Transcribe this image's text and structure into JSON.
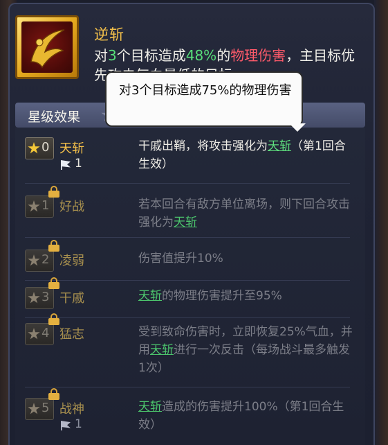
{
  "skill": {
    "name": "逆斩",
    "desc_p1": "对",
    "desc_targets": "3",
    "desc_p2": "个目标造成",
    "desc_percent": "48%",
    "desc_p3": "的",
    "desc_damage": "物理伤害",
    "desc_p4": "，主目标优先攻击气血最低的目标",
    "icon": "crimson-slash-skill-icon"
  },
  "tooltip": {
    "text": "对3个目标造成75%的物理伤害"
  },
  "star_section": {
    "title": "星级效果"
  },
  "effects": [
    {
      "stars": "0",
      "name": "天斩",
      "active": true,
      "locked": false,
      "flag_count": "1",
      "desc_parts": [
        {
          "text": "干戚出鞘，将攻击强化为"
        },
        {
          "text": "天斩",
          "link": true
        },
        {
          "text": "（第1回合生效）"
        }
      ]
    },
    {
      "stars": "1",
      "name": "好战",
      "active": false,
      "locked": true,
      "desc_parts": [
        {
          "text": "若本回合有敌方单位离场，则下回合攻击强化为"
        },
        {
          "text": "天斩",
          "link": true
        }
      ]
    },
    {
      "stars": "2",
      "name": "凌弱",
      "active": false,
      "locked": true,
      "desc_parts": [
        {
          "text": "伤害值提升10%"
        }
      ]
    },
    {
      "stars": "3",
      "name": "干戚",
      "active": false,
      "locked": true,
      "desc_parts": [
        {
          "text": "天斩",
          "link": true
        },
        {
          "text": "的物理伤害提升至95%"
        }
      ]
    },
    {
      "stars": "4",
      "name": "猛志",
      "active": false,
      "locked": true,
      "desc_parts": [
        {
          "text": "受到致命伤害时，立即恢复25%气血，并用"
        },
        {
          "text": "天斩",
          "link": true
        },
        {
          "text": "进行一次反击（每场战斗最多触发1次）"
        }
      ]
    },
    {
      "stars": "5",
      "name": "战神",
      "active": false,
      "locked": true,
      "flag_count": "1",
      "desc_parts": [
        {
          "text": "天斩",
          "link": true
        },
        {
          "text": "造成的伤害提升100%（第1回合生效）"
        }
      ]
    }
  ]
}
